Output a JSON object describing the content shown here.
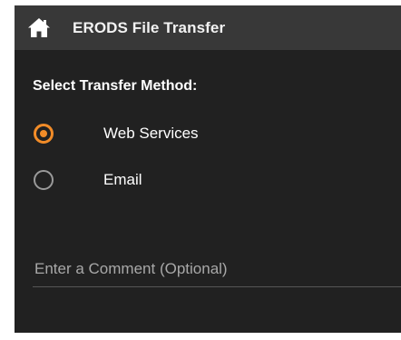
{
  "header": {
    "title": "ERODS File Transfer",
    "home_icon": "home-icon"
  },
  "transfer_method": {
    "heading": "Select Transfer Method:",
    "options": [
      {
        "label": "Web Services",
        "selected": true
      },
      {
        "label": "Email",
        "selected": false
      }
    ]
  },
  "comment": {
    "placeholder": "Enter a Comment (Optional)",
    "value": ""
  },
  "colors": {
    "accent": "#f28c28",
    "background": "#212121",
    "titlebar": "#383838"
  }
}
